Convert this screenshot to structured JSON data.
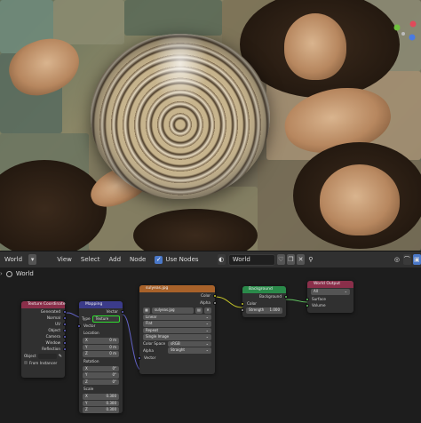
{
  "header": {
    "world_label": "World",
    "menu": [
      "View",
      "Select",
      "Add",
      "Node"
    ],
    "use_nodes_label": "Use Nodes",
    "world_datablock": "World"
  },
  "breadcrumb": {
    "item": "World"
  },
  "nodes": {
    "texture_coordinate": {
      "title": "Texture Coordinate",
      "outputs": [
        "Generated",
        "Normal",
        "UV",
        "Object",
        "Camera",
        "Window",
        "Reflection"
      ],
      "object_label": "Object",
      "from_instancer": "From Instancer"
    },
    "mapping": {
      "title": "Mapping",
      "output": "Vector",
      "type_label": "Type",
      "type_value": "Texture",
      "vector_label": "Vector",
      "location_label": "Location",
      "location": [
        {
          "axis": "X",
          "value": "0 m"
        },
        {
          "axis": "Y",
          "value": "0 m"
        },
        {
          "axis": "Z",
          "value": "0 m"
        }
      ],
      "rotation_label": "Rotation",
      "rotation": [
        {
          "axis": "X",
          "value": "0°"
        },
        {
          "axis": "Y",
          "value": "0°"
        },
        {
          "axis": "Z",
          "value": "0°"
        }
      ],
      "scale_label": "Scale",
      "scale": [
        {
          "axis": "X",
          "value": "0.300"
        },
        {
          "axis": "Y",
          "value": "0.300"
        },
        {
          "axis": "Z",
          "value": "0.300"
        }
      ]
    },
    "image_texture": {
      "title": "sulyeas.jpg",
      "out_color": "Color",
      "out_alpha": "Alpha",
      "image_name": "sulyeas.jpg",
      "interpolation": "Linear",
      "projection": "Flat",
      "extension": "Repeat",
      "source": "Single Image",
      "color_space_label": "Color Space",
      "color_space_value": "sRGB",
      "alpha_label": "Alpha",
      "alpha_value": "Straight",
      "vector_label": "Vector"
    },
    "background": {
      "title": "Background",
      "output": "Background",
      "color_label": "Color",
      "strength_label": "Strength",
      "strength_value": "1.000"
    },
    "world_output": {
      "title": "World Output",
      "target": "All",
      "surface": "Surface",
      "volume": "Volume"
    }
  },
  "colors": {
    "node_input_header": "#8a2f4a",
    "node_vector_header": "#3b3b8a",
    "node_texture_header": "#a8622a",
    "node_shader_header": "#2a8a4a",
    "node_output_header": "#8a2f4a",
    "highlight": "#2fdc2f"
  }
}
